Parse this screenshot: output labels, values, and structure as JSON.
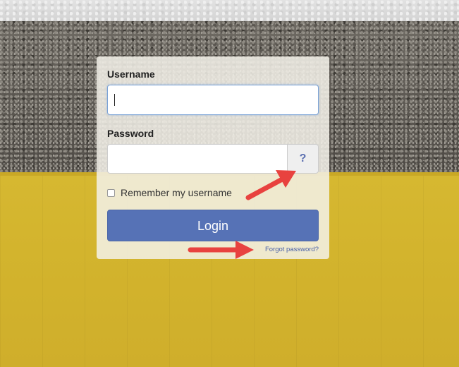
{
  "login": {
    "username_label": "Username",
    "username_value": "",
    "password_label": "Password",
    "password_value": "",
    "help_label": "?",
    "remember_label": "Remember my username",
    "remember_checked": false,
    "login_label": "Login",
    "forgot_label": "Forgot password?"
  },
  "colors": {
    "panel": "#f3f1e9",
    "button": "#5672b6",
    "link": "#4b62a8",
    "arrow": "#e8423f",
    "background_yellow": "#d6b831"
  },
  "annotations": {
    "arrow_icon": "red-arrow-icon"
  }
}
